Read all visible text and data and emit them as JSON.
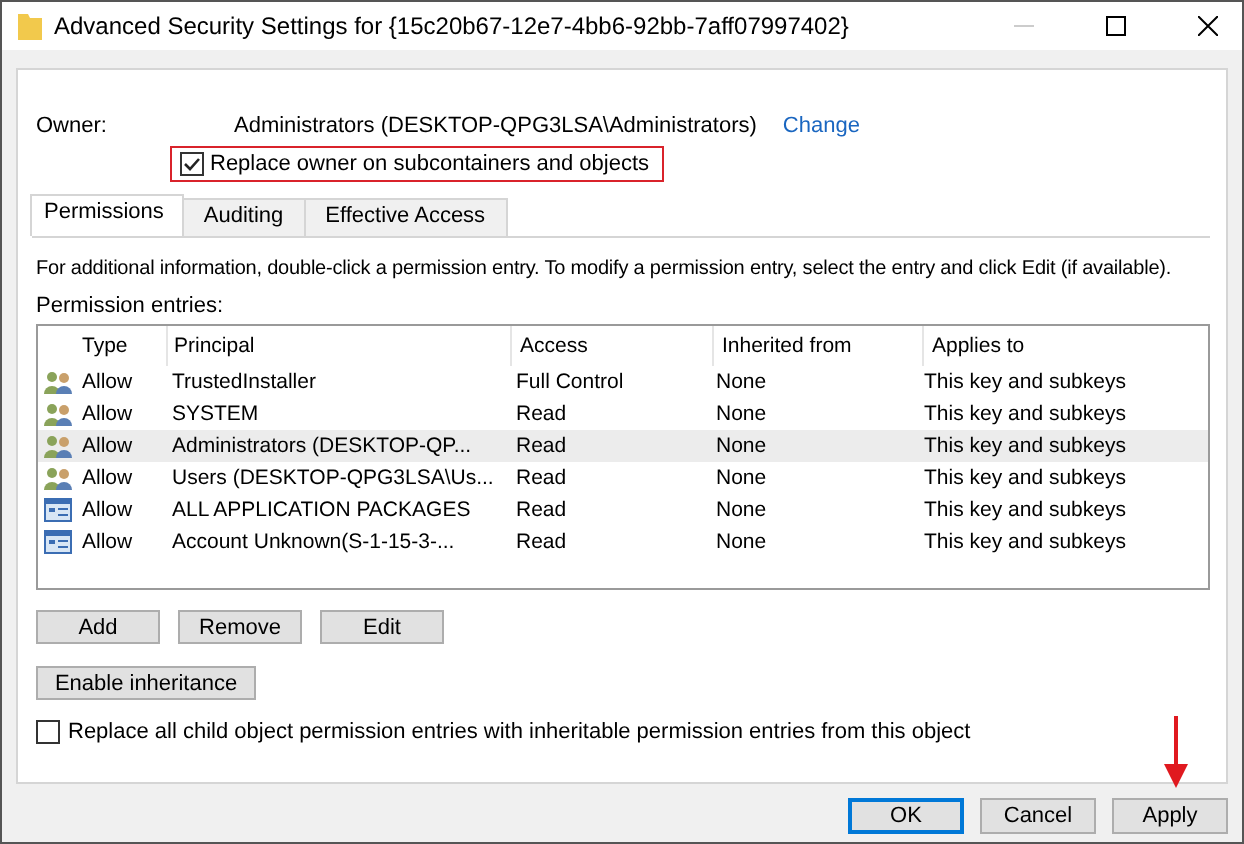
{
  "window": {
    "title": "Advanced Security Settings for {15c20b67-12e7-4bb6-92bb-7aff07997402}"
  },
  "owner": {
    "label": "Owner:",
    "value": "Administrators (DESKTOP-QPG3LSA\\Administrators)",
    "link": "Change",
    "replace_checkbox": {
      "label": "Replace owner on subcontainers and objects",
      "checked": true,
      "highlighted": true
    }
  },
  "tabs": [
    {
      "label": "Permissions",
      "selected": true
    },
    {
      "label": "Auditing",
      "selected": false
    },
    {
      "label": "Effective Access",
      "selected": false
    }
  ],
  "info": "For additional information, double-click a permission entry. To modify a permission entry, select the entry and click Edit (if available).",
  "entries_label": "Permission entries:",
  "table": {
    "columns": [
      "Type",
      "Principal",
      "Access",
      "Inherited from",
      "Applies to"
    ],
    "rows": [
      {
        "kind": "group",
        "selected": false,
        "cells": [
          "Allow",
          "TrustedInstaller",
          "Full Control",
          "None",
          "This key and subkeys"
        ]
      },
      {
        "kind": "group",
        "selected": false,
        "cells": [
          "Allow",
          "SYSTEM",
          "Read",
          "None",
          "This key and subkeys"
        ]
      },
      {
        "kind": "group",
        "selected": true,
        "cells": [
          "Allow",
          "Administrators (DESKTOP-QP...",
          "Read",
          "None",
          "This key and subkeys"
        ]
      },
      {
        "kind": "group",
        "selected": false,
        "cells": [
          "Allow",
          "Users (DESKTOP-QPG3LSA\\Us...",
          "Read",
          "None",
          "This key and subkeys"
        ]
      },
      {
        "kind": "package",
        "selected": false,
        "cells": [
          "Allow",
          "ALL APPLICATION PACKAGES",
          "Read",
          "None",
          "This key and subkeys"
        ]
      },
      {
        "kind": "package",
        "selected": false,
        "cells": [
          "Allow",
          "Account Unknown(S-1-15-3-...",
          "Read",
          "None",
          "This key and subkeys"
        ]
      }
    ]
  },
  "entry_buttons": [
    "Add",
    "Remove",
    "Edit"
  ],
  "inheritance_button": "Enable inheritance",
  "replace_child_checkbox": {
    "label": "Replace all child object permission entries with inheritable permission entries from this object",
    "checked": false
  },
  "dialog_buttons": [
    {
      "label": "OK",
      "default": true,
      "pointed": false
    },
    {
      "label": "Cancel",
      "default": false,
      "pointed": false
    },
    {
      "label": "Apply",
      "default": false,
      "pointed": true
    }
  ]
}
